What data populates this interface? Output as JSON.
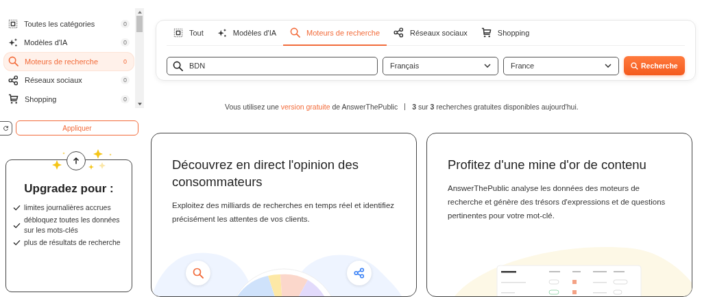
{
  "sidebar": {
    "categories": [
      {
        "kind": "all",
        "label": "Toutes les catégories",
        "count": "0",
        "selected": false
      },
      {
        "kind": "ai",
        "label": "Modèles d'IA",
        "count": "0",
        "selected": false
      },
      {
        "kind": "search",
        "label": "Moteurs de recherche",
        "count": "0",
        "selected": true
      },
      {
        "kind": "social",
        "label": "Réseaux sociaux",
        "count": "0",
        "selected": false
      },
      {
        "kind": "cart",
        "label": "Shopping",
        "count": "0",
        "selected": false
      }
    ],
    "apply_button": "Appliquer",
    "upgrade": {
      "title": "Upgradez pour :",
      "items": [
        "limites journalières accrues",
        "débloquez toutes les données sur les mots-clés",
        "plus de résultats de recherche"
      ]
    }
  },
  "tabs": [
    {
      "kind": "all",
      "label": "Tout",
      "selected": false
    },
    {
      "kind": "ai",
      "label": "Modèles d'IA",
      "selected": false
    },
    {
      "kind": "search",
      "label": "Moteurs de recherche",
      "selected": true
    },
    {
      "kind": "social",
      "label": "Réseaux sociaux",
      "selected": false
    },
    {
      "kind": "cart",
      "label": "Shopping",
      "selected": false
    }
  ],
  "search": {
    "value": "BDN",
    "language": "Français",
    "country": "France",
    "button": "Recherche"
  },
  "notice_link": "version gratuite",
  "notice_before": "Vous utilisez une",
  "notice_after": "de AnswerThePublic",
  "quota": "**3** sur **3** recherches gratuites disponibles aujourd'hui.",
  "cards": [
    {
      "title": "Découvrez en direct l'opinion des consommateurs",
      "text": "Exploitez des milliards de recherches en temps réel et identifiez précisément les attentes de vos clients.",
      "kind": "chart"
    },
    {
      "title": "Profitez d'une mine d'or de contenu",
      "text": "AnswerThePublic analyse les données des moteurs de recherche et génère des trésors d'expressions et de questions pertinentes pour votre mot-clé.",
      "kind": "table"
    }
  ]
}
